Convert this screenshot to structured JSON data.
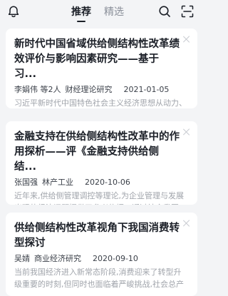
{
  "header": {
    "tabs": [
      {
        "label": "推荐",
        "active": true
      },
      {
        "label": "精选",
        "active": false
      }
    ],
    "icons": [
      "bell-icon",
      "search-icon",
      "scan-icon"
    ]
  },
  "cards": [
    {
      "title": "新时代中国省域供给侧结构性改革绩效评价与影响因素研究——基于习...",
      "authors": "李娟伟 等2人",
      "source": "财经理论研究",
      "date": "2021-01-05",
      "abstract": "习近平新时代中国特色社会主义经济思想从动力、内容、目的三个方面对供给侧结构性改革做了深..."
    },
    {
      "title": "金融支持在供给侧结构性改革中的作用探析——评《金融支持供给侧结...",
      "authors": "张国强",
      "source": "林产工业",
      "date": "2020-10-06",
      "abstract": "近年来,供给侧管理调控等理论,为企业管理与发展出现的经济问题提供了参考依据。通过结合我国当..."
    },
    {
      "title": "供给侧结构性改革视角下我国消费转型探讨",
      "authors": "吴婧",
      "source": "商业经济研究",
      "date": "2020-09-10",
      "abstract": "当前我国经济进入新常态阶段,消费迎来了转型升级重要的时刻,但同时也面临着严峻挑战,社会总产能..."
    }
  ]
}
